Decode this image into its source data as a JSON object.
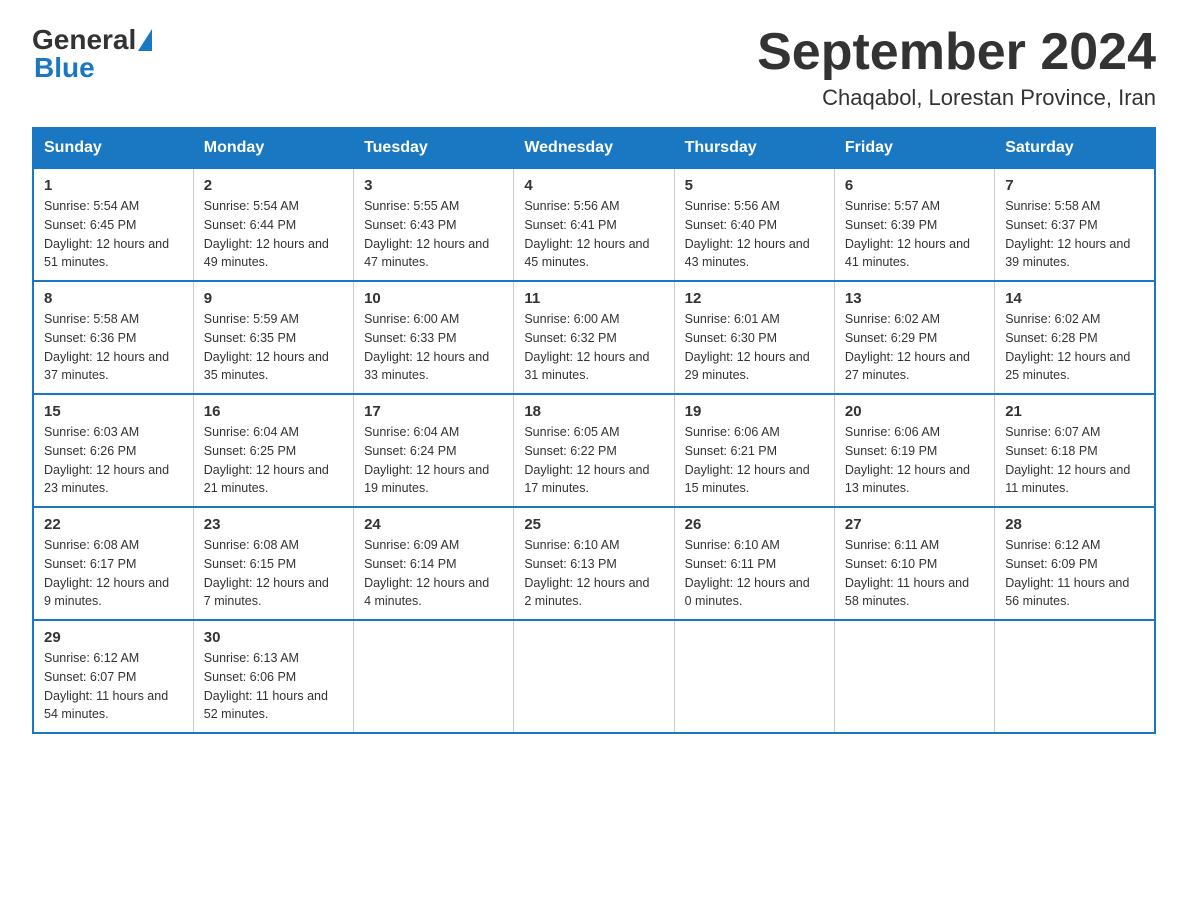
{
  "header": {
    "logo_general": "General",
    "logo_blue": "Blue",
    "title": "September 2024",
    "subtitle": "Chaqabol, Lorestan Province, Iran"
  },
  "calendar": {
    "days_of_week": [
      "Sunday",
      "Monday",
      "Tuesday",
      "Wednesday",
      "Thursday",
      "Friday",
      "Saturday"
    ],
    "weeks": [
      [
        {
          "day": "1",
          "sunrise": "Sunrise: 5:54 AM",
          "sunset": "Sunset: 6:45 PM",
          "daylight": "Daylight: 12 hours and 51 minutes."
        },
        {
          "day": "2",
          "sunrise": "Sunrise: 5:54 AM",
          "sunset": "Sunset: 6:44 PM",
          "daylight": "Daylight: 12 hours and 49 minutes."
        },
        {
          "day": "3",
          "sunrise": "Sunrise: 5:55 AM",
          "sunset": "Sunset: 6:43 PM",
          "daylight": "Daylight: 12 hours and 47 minutes."
        },
        {
          "day": "4",
          "sunrise": "Sunrise: 5:56 AM",
          "sunset": "Sunset: 6:41 PM",
          "daylight": "Daylight: 12 hours and 45 minutes."
        },
        {
          "day": "5",
          "sunrise": "Sunrise: 5:56 AM",
          "sunset": "Sunset: 6:40 PM",
          "daylight": "Daylight: 12 hours and 43 minutes."
        },
        {
          "day": "6",
          "sunrise": "Sunrise: 5:57 AM",
          "sunset": "Sunset: 6:39 PM",
          "daylight": "Daylight: 12 hours and 41 minutes."
        },
        {
          "day": "7",
          "sunrise": "Sunrise: 5:58 AM",
          "sunset": "Sunset: 6:37 PM",
          "daylight": "Daylight: 12 hours and 39 minutes."
        }
      ],
      [
        {
          "day": "8",
          "sunrise": "Sunrise: 5:58 AM",
          "sunset": "Sunset: 6:36 PM",
          "daylight": "Daylight: 12 hours and 37 minutes."
        },
        {
          "day": "9",
          "sunrise": "Sunrise: 5:59 AM",
          "sunset": "Sunset: 6:35 PM",
          "daylight": "Daylight: 12 hours and 35 minutes."
        },
        {
          "day": "10",
          "sunrise": "Sunrise: 6:00 AM",
          "sunset": "Sunset: 6:33 PM",
          "daylight": "Daylight: 12 hours and 33 minutes."
        },
        {
          "day": "11",
          "sunrise": "Sunrise: 6:00 AM",
          "sunset": "Sunset: 6:32 PM",
          "daylight": "Daylight: 12 hours and 31 minutes."
        },
        {
          "day": "12",
          "sunrise": "Sunrise: 6:01 AM",
          "sunset": "Sunset: 6:30 PM",
          "daylight": "Daylight: 12 hours and 29 minutes."
        },
        {
          "day": "13",
          "sunrise": "Sunrise: 6:02 AM",
          "sunset": "Sunset: 6:29 PM",
          "daylight": "Daylight: 12 hours and 27 minutes."
        },
        {
          "day": "14",
          "sunrise": "Sunrise: 6:02 AM",
          "sunset": "Sunset: 6:28 PM",
          "daylight": "Daylight: 12 hours and 25 minutes."
        }
      ],
      [
        {
          "day": "15",
          "sunrise": "Sunrise: 6:03 AM",
          "sunset": "Sunset: 6:26 PM",
          "daylight": "Daylight: 12 hours and 23 minutes."
        },
        {
          "day": "16",
          "sunrise": "Sunrise: 6:04 AM",
          "sunset": "Sunset: 6:25 PM",
          "daylight": "Daylight: 12 hours and 21 minutes."
        },
        {
          "day": "17",
          "sunrise": "Sunrise: 6:04 AM",
          "sunset": "Sunset: 6:24 PM",
          "daylight": "Daylight: 12 hours and 19 minutes."
        },
        {
          "day": "18",
          "sunrise": "Sunrise: 6:05 AM",
          "sunset": "Sunset: 6:22 PM",
          "daylight": "Daylight: 12 hours and 17 minutes."
        },
        {
          "day": "19",
          "sunrise": "Sunrise: 6:06 AM",
          "sunset": "Sunset: 6:21 PM",
          "daylight": "Daylight: 12 hours and 15 minutes."
        },
        {
          "day": "20",
          "sunrise": "Sunrise: 6:06 AM",
          "sunset": "Sunset: 6:19 PM",
          "daylight": "Daylight: 12 hours and 13 minutes."
        },
        {
          "day": "21",
          "sunrise": "Sunrise: 6:07 AM",
          "sunset": "Sunset: 6:18 PM",
          "daylight": "Daylight: 12 hours and 11 minutes."
        }
      ],
      [
        {
          "day": "22",
          "sunrise": "Sunrise: 6:08 AM",
          "sunset": "Sunset: 6:17 PM",
          "daylight": "Daylight: 12 hours and 9 minutes."
        },
        {
          "day": "23",
          "sunrise": "Sunrise: 6:08 AM",
          "sunset": "Sunset: 6:15 PM",
          "daylight": "Daylight: 12 hours and 7 minutes."
        },
        {
          "day": "24",
          "sunrise": "Sunrise: 6:09 AM",
          "sunset": "Sunset: 6:14 PM",
          "daylight": "Daylight: 12 hours and 4 minutes."
        },
        {
          "day": "25",
          "sunrise": "Sunrise: 6:10 AM",
          "sunset": "Sunset: 6:13 PM",
          "daylight": "Daylight: 12 hours and 2 minutes."
        },
        {
          "day": "26",
          "sunrise": "Sunrise: 6:10 AM",
          "sunset": "Sunset: 6:11 PM",
          "daylight": "Daylight: 12 hours and 0 minutes."
        },
        {
          "day": "27",
          "sunrise": "Sunrise: 6:11 AM",
          "sunset": "Sunset: 6:10 PM",
          "daylight": "Daylight: 11 hours and 58 minutes."
        },
        {
          "day": "28",
          "sunrise": "Sunrise: 6:12 AM",
          "sunset": "Sunset: 6:09 PM",
          "daylight": "Daylight: 11 hours and 56 minutes."
        }
      ],
      [
        {
          "day": "29",
          "sunrise": "Sunrise: 6:12 AM",
          "sunset": "Sunset: 6:07 PM",
          "daylight": "Daylight: 11 hours and 54 minutes."
        },
        {
          "day": "30",
          "sunrise": "Sunrise: 6:13 AM",
          "sunset": "Sunset: 6:06 PM",
          "daylight": "Daylight: 11 hours and 52 minutes."
        },
        null,
        null,
        null,
        null,
        null
      ]
    ]
  }
}
